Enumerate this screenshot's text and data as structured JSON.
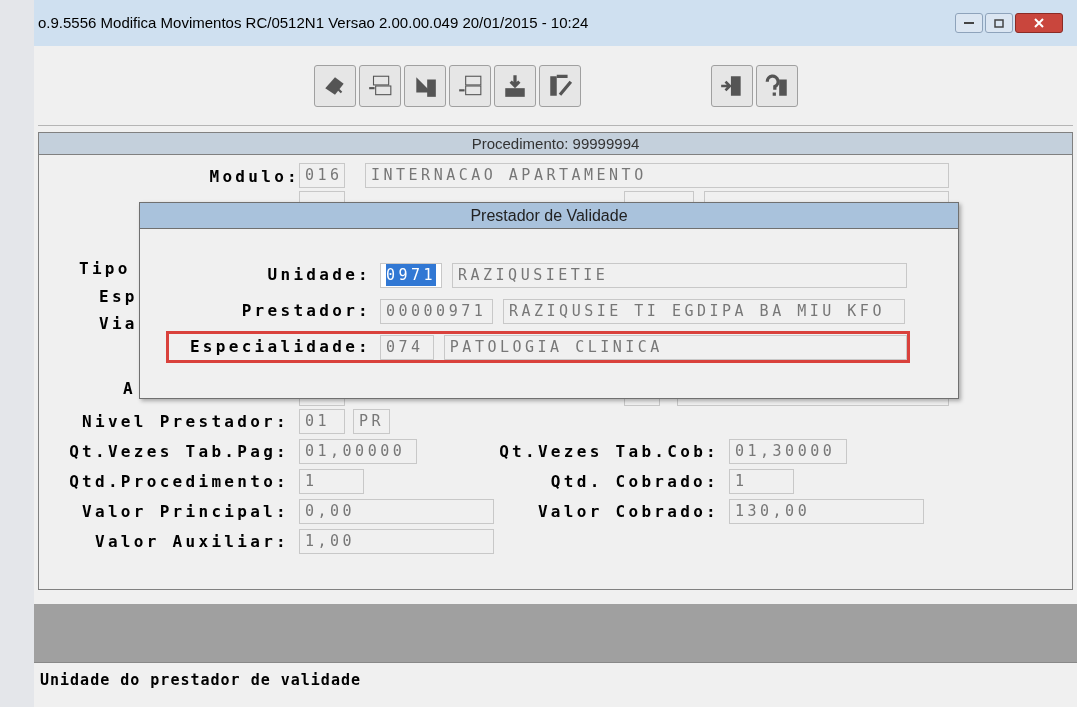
{
  "window": {
    "title": "o.9.5556 Modifica  Movimentos RC/0512N1 Versao 2.00.00.049 20/01/2015 - 10:24"
  },
  "panel": {
    "header": "Procedimento: 99999994"
  },
  "form": {
    "top_row": {
      "label": "Modulo:",
      "fields": [
        "016",
        "INTERNACAO APARTAMENTO"
      ]
    },
    "hidden_labels": [
      "Tipo",
      "Esp",
      "Via",
      "A"
    ],
    "rows": [
      {
        "left": {
          "label": "Nivel Prestador:",
          "fields": [
            "01",
            "PR"
          ]
        }
      },
      {
        "left": {
          "label": "Qt.Vezes Tab.Pag:",
          "fields": [
            "01,00000"
          ]
        },
        "right": {
          "label": "Qt.Vezes Tab.Cob:",
          "fields": [
            "01,30000"
          ]
        }
      },
      {
        "left": {
          "label": "Qtd.Procedimento:",
          "fields": [
            "1"
          ]
        },
        "right": {
          "label": "Qtd. Cobrado:",
          "fields": [
            "1"
          ]
        }
      },
      {
        "left": {
          "label": "Valor Principal:",
          "fields": [
            "0,00"
          ]
        },
        "right": {
          "label": "Valor Cobrado:",
          "fields": [
            "130,00"
          ]
        }
      },
      {
        "left": {
          "label": "Valor Auxiliar:",
          "fields": [
            "1,00"
          ]
        }
      }
    ]
  },
  "dialog": {
    "title": "Prestador de Validade",
    "rows": [
      {
        "label": "Unidade:",
        "code": "0971",
        "code_selected": true,
        "description": "RAZIQUSIETIE",
        "highlighted": false
      },
      {
        "label": "Prestador:",
        "code": "00000971",
        "code_selected": false,
        "description": "RAZIQUSIE TI EGDIPA BA MIU KFO",
        "highlighted": false
      },
      {
        "label": "Especialidade:",
        "code": "074",
        "code_selected": false,
        "description": "PATOLOGIA CLINICA",
        "highlighted": true
      }
    ]
  },
  "status_bar": {
    "text": "Unidade do prestador de validade"
  }
}
